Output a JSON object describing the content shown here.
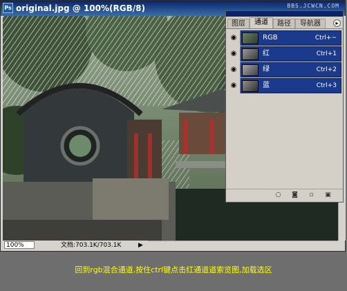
{
  "window": {
    "title": "original.jpg @ 100%(RGB/8)",
    "app_icon_text": "Ps",
    "watermark": "BBS.JCWCN.COM"
  },
  "status": {
    "zoom": "100%",
    "doc_info": "文档:703.1K/703.1K",
    "arrow": "▶"
  },
  "panel": {
    "tabs": [
      "图层",
      "通道",
      "路径",
      "导航器"
    ],
    "active_tab": 1,
    "channels": [
      {
        "name": "RGB",
        "shortcut": "Ctrl+~"
      },
      {
        "name": "红",
        "shortcut": "Ctrl+1"
      },
      {
        "name": "绿",
        "shortcut": "Ctrl+2"
      },
      {
        "name": "蓝",
        "shortcut": "Ctrl+3"
      }
    ],
    "footer_icons": [
      "load-selection-icon",
      "save-selection-icon",
      "new-channel-icon",
      "delete-channel-icon"
    ]
  },
  "caption": "回到rgb混合通道,按住ctrl键点击红通道道索览图,加载选区"
}
